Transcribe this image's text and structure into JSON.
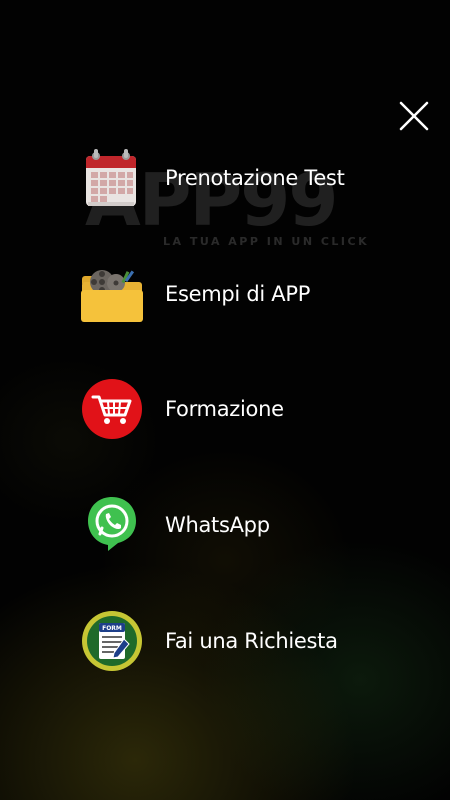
{
  "logo": {
    "text": "APP99",
    "tagline": "LA TUA APP IN UN CLICK"
  },
  "menu": {
    "items": [
      {
        "label": "Prenotazione Test",
        "icon": "calendar-icon"
      },
      {
        "label": "Esempi di APP",
        "icon": "folder-icon"
      },
      {
        "label": "Formazione",
        "icon": "shopping-cart-icon"
      },
      {
        "label": "WhatsApp",
        "icon": "whatsapp-icon"
      },
      {
        "label": "Fai una Richiesta",
        "icon": "form-icon"
      }
    ],
    "close_icon": "close-icon"
  },
  "form_icon_text": "FORM",
  "colors": {
    "background": "#000000",
    "text": "#ffffff",
    "cart_red": "#e11218",
    "whatsapp_green": "#3fc14f",
    "form_green": "#1f6a2a",
    "folder_yellow": "#f5c23b"
  }
}
